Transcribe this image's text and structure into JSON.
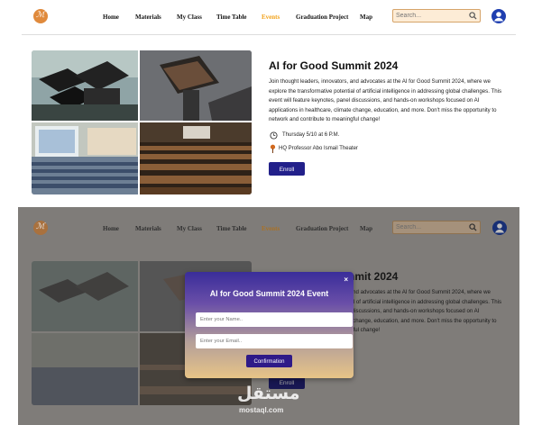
{
  "nav": {
    "links": [
      "Home",
      "Materials",
      "My Class",
      "Time Table",
      "Events",
      "Graduation Project",
      "Map"
    ],
    "active": "Events",
    "search_placeholder": "Search..."
  },
  "event": {
    "title": "AI for Good Summit 2024",
    "description": "Join thought leaders, innovators, and advocates at the AI for Good Summit 2024, where we explore the transformative potential of artificial intelligence in addressing global challenges. This event will feature keynotes, panel discussions, and hands-on workshops focused on AI applications in healthcare, climate change, education, and more. Don't miss the opportunity to network and contribute to meaningful change!",
    "datetime": "Thursday 5/10 at 6 P.M.",
    "location": "HQ Professor Abo Ismail Theater",
    "enroll_label": "Enroll"
  },
  "modal": {
    "title": "AI for Good Summit 2024 Event",
    "close_label": "×",
    "name_placeholder": "Enter your Name..",
    "email_placeholder": "Enter your Email..",
    "confirm_label": "Confirmation"
  },
  "watermark": {
    "arabic": "مستقل",
    "latin": "mostaql.com"
  },
  "colors": {
    "accent": "#f2a21a",
    "button": "#22208a",
    "avatar": "#1f3fb0",
    "search_bg": "#fdecd6"
  }
}
